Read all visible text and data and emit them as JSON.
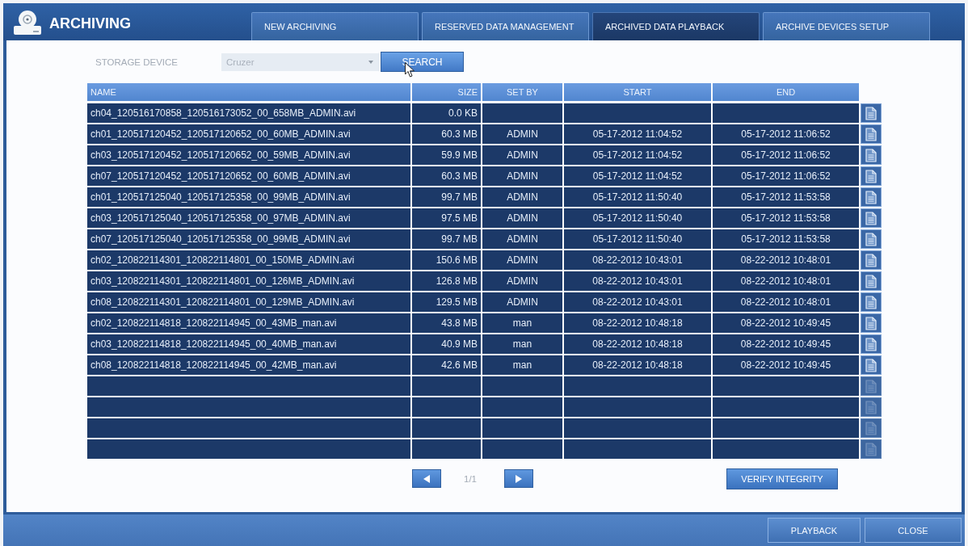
{
  "window": {
    "title": "ARCHIVING"
  },
  "tabs": [
    {
      "label": "NEW ARCHIVING",
      "selected": false
    },
    {
      "label": "RESERVED DATA MANAGEMENT",
      "selected": false
    },
    {
      "label": "ARCHIVED DATA PLAYBACK",
      "selected": true
    },
    {
      "label": "ARCHIVE DEVICES SETUP",
      "selected": false
    }
  ],
  "storage": {
    "label": "STORAGE DEVICE",
    "value": "Cruzer",
    "search_button": {
      "label": "SEARCH",
      "hovered": true
    }
  },
  "table": {
    "columns": [
      "NAME",
      "SIZE",
      "SET BY",
      "START",
      "END"
    ],
    "rows": [
      {
        "kind": "file",
        "name": "ch04_120516170858_120516173052_00_658MB_ADMIN.avi",
        "size": "0.0 KB"
      },
      {
        "kind": "file",
        "name": "ch01_120517120452_120517120652_00_60MB_ADMIN.avi",
        "size": "60.3 MB",
        "set_by": "ADMIN",
        "start": "05-17-2012 11:04:52",
        "end": "05-17-2012 11:06:52"
      },
      {
        "kind": "file",
        "name": "ch03_120517120452_120517120652_00_59MB_ADMIN.avi",
        "size": "59.9 MB",
        "set_by": "ADMIN",
        "start": "05-17-2012 11:04:52",
        "end": "05-17-2012 11:06:52"
      },
      {
        "kind": "file",
        "name": "ch07_120517120452_120517120652_00_60MB_ADMIN.avi",
        "size": "60.3 MB",
        "set_by": "ADMIN",
        "start": "05-17-2012 11:04:52",
        "end": "05-17-2012 11:06:52"
      },
      {
        "kind": "file",
        "name": "ch01_120517125040_120517125358_00_99MB_ADMIN.avi",
        "size": "99.7 MB",
        "set_by": "ADMIN",
        "start": "05-17-2012 11:50:40",
        "end": "05-17-2012 11:53:58"
      },
      {
        "kind": "file",
        "name": "ch03_120517125040_120517125358_00_97MB_ADMIN.avi",
        "size": "97.5 MB",
        "set_by": "ADMIN",
        "start": "05-17-2012 11:50:40",
        "end": "05-17-2012 11:53:58"
      },
      {
        "kind": "file",
        "name": "ch07_120517125040_120517125358_00_99MB_ADMIN.avi",
        "size": "99.7 MB",
        "set_by": "ADMIN",
        "start": "05-17-2012 11:50:40",
        "end": "05-17-2012 11:53:58"
      },
      {
        "kind": "file",
        "name": "ch02_120822114301_120822114801_00_150MB_ADMIN.avi",
        "size": "150.6 MB",
        "set_by": "ADMIN",
        "start": "08-22-2012 10:43:01",
        "end": "08-22-2012 10:48:01"
      },
      {
        "kind": "file",
        "name": "ch03_120822114301_120822114801_00_126MB_ADMIN.avi",
        "size": "126.8 MB",
        "set_by": "ADMIN",
        "start": "08-22-2012 10:43:01",
        "end": "08-22-2012 10:48:01"
      },
      {
        "kind": "file",
        "name": "ch08_120822114301_120822114801_00_129MB_ADMIN.avi",
        "size": "129.5 MB",
        "set_by": "ADMIN",
        "start": "08-22-2012 10:43:01",
        "end": "08-22-2012 10:48:01"
      },
      {
        "kind": "file",
        "name": "ch02_120822114818_120822114945_00_43MB_man.avi",
        "size": "43.8 MB",
        "set_by": "man",
        "start": "08-22-2012 10:48:18",
        "end": "08-22-2012 10:49:45"
      },
      {
        "kind": "file",
        "name": "ch03_120822114818_120822114945_00_40MB_man.avi",
        "size": "40.9 MB",
        "set_by": "man",
        "start": "08-22-2012 10:48:18",
        "end": "08-22-2012 10:49:45"
      },
      {
        "kind": "file",
        "name": "ch08_120822114818_120822114945_00_42MB_man.avi",
        "size": "42.6 MB",
        "set_by": "man",
        "start": "08-22-2012 10:48:18",
        "end": "08-22-2012 10:49:45"
      },
      {
        "kind": "empty"
      },
      {
        "kind": "empty"
      },
      {
        "kind": "empty"
      },
      {
        "kind": "empty"
      }
    ]
  },
  "pagination": {
    "page": "1/1"
  },
  "verify_button": "VERIFY INTEGRITY",
  "footer_buttons": [
    "PLAYBACK",
    "CLOSE"
  ]
}
